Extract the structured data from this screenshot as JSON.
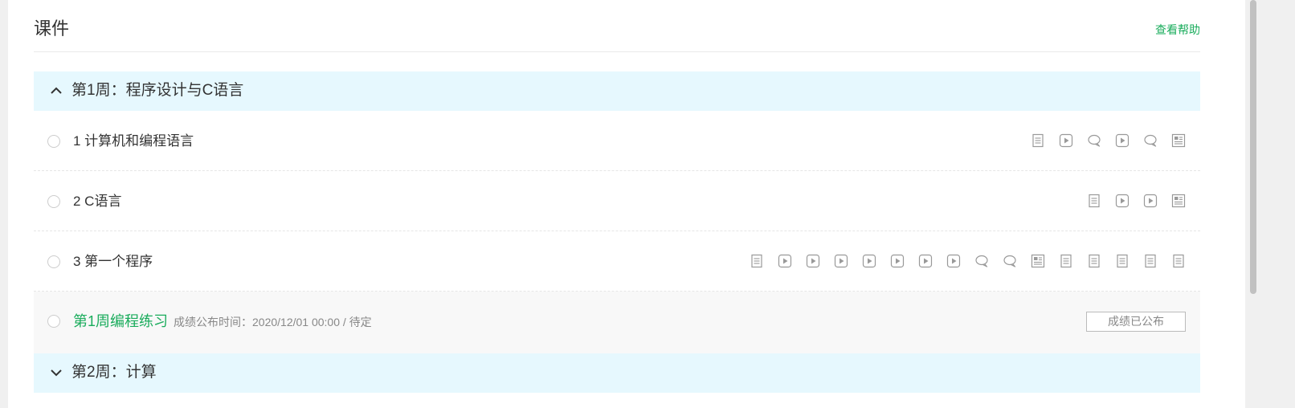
{
  "header": {
    "title": "课件",
    "help_link": "查看帮助"
  },
  "weeks": [
    {
      "title": "第1周：程序设计与C语言",
      "expanded": true,
      "lessons": [
        {
          "label": "1 计算机和编程语言",
          "icons": [
            "document-icon",
            "video-icon",
            "discussion-icon",
            "video-icon",
            "discussion-icon",
            "article-icon"
          ]
        },
        {
          "label": "2 C语言",
          "icons": [
            "document-icon",
            "video-icon",
            "video-icon",
            "article-icon"
          ]
        },
        {
          "label": "3 第一个程序",
          "icons": [
            "document-icon",
            "video-icon",
            "video-icon",
            "video-icon",
            "video-icon",
            "video-icon",
            "video-icon",
            "video-icon",
            "discussion-icon",
            "discussion-icon",
            "article-icon",
            "document-icon",
            "document-icon",
            "document-icon",
            "document-icon",
            "document-icon"
          ]
        }
      ],
      "exercise": {
        "title": "第1周编程练习",
        "meta": "成绩公布时间：2020/12/01 00:00 / 待定",
        "status": "成绩已公布"
      }
    },
    {
      "title": "第2周：计算",
      "expanded": false
    }
  ],
  "colors": {
    "accent": "#1aac5c",
    "week_bg": "#e6f8fe",
    "icon": "#999999"
  }
}
